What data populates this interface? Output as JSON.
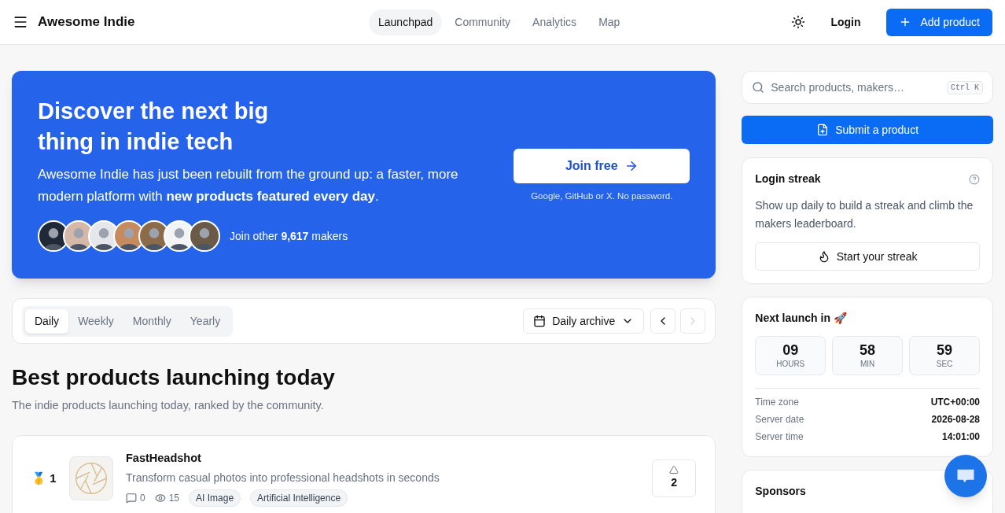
{
  "header": {
    "brand": "Awesome Indie",
    "nav": [
      {
        "label": "Launchpad",
        "selected": true
      },
      {
        "label": "Community",
        "selected": false
      },
      {
        "label": "Analytics",
        "selected": false
      },
      {
        "label": "Map",
        "selected": false
      }
    ],
    "login": "Login",
    "add_button": "Add product"
  },
  "hero": {
    "title_lines": [
      "Discover the next big",
      "thing in indie tech"
    ],
    "text": "Awesome Indie has just been rebuilt from the ground up: a faster, more modern platform with **new products featured every day**.",
    "cta": "Join free",
    "cta_note": "Google, GitHub or X. No password.",
    "avatars": [
      {
        "kind": "picture"
      },
      {
        "kind": "picture"
      },
      {
        "kind": "picture"
      },
      {
        "kind": "picture"
      },
      {
        "kind": "picture"
      },
      {
        "kind": "picture"
      },
      {
        "kind": "picture"
      }
    ],
    "makers": "Join other **9,617** makers"
  },
  "period_tabs": [
    {
      "label": "Daily",
      "selected": true
    },
    {
      "label": "Weekly",
      "selected": false
    },
    {
      "label": "Monthly",
      "selected": false
    },
    {
      "label": "Yearly",
      "selected": false
    }
  ],
  "archive": {
    "label": "Daily archive",
    "prev_disabled": false,
    "next_disabled": true
  },
  "section": {
    "title": "Best products launching today",
    "subtitle": "The indie products launching today, ranked by the community."
  },
  "products": [
    {
      "medal": "🥇",
      "rank": "1",
      "name": "FastHeadshot",
      "tagline": "Transform casual photos into professional headshots in seconds",
      "comments": "0",
      "views": "15",
      "tags": [
        "AI Image",
        "Artificial Intelligence"
      ],
      "votes": "2"
    }
  ],
  "sidebar": {
    "search": {
      "placeholder": "Search products, makers…",
      "shortcut": "Ctrl K"
    },
    "submit": "Submit a product",
    "streak": {
      "title": "Login streak",
      "text": "Show up daily to build a streak and climb the makers leaderboard.",
      "button": "Start your streak"
    },
    "countdown": {
      "title": "Next launch in 🚀",
      "units": [
        {
          "value": "09",
          "label": "HOURS"
        },
        {
          "value": "58",
          "label": "MIN"
        },
        {
          "value": "59",
          "label": "SEC"
        }
      ],
      "info": [
        {
          "label": "Time zone",
          "value": "UTC+00:00"
        },
        {
          "label": "Server date",
          "value": "2026-08-28"
        },
        {
          "label": "Server time",
          "value": "14:01:00"
        }
      ]
    },
    "sponsors": {
      "title": "Sponsors"
    }
  }
}
